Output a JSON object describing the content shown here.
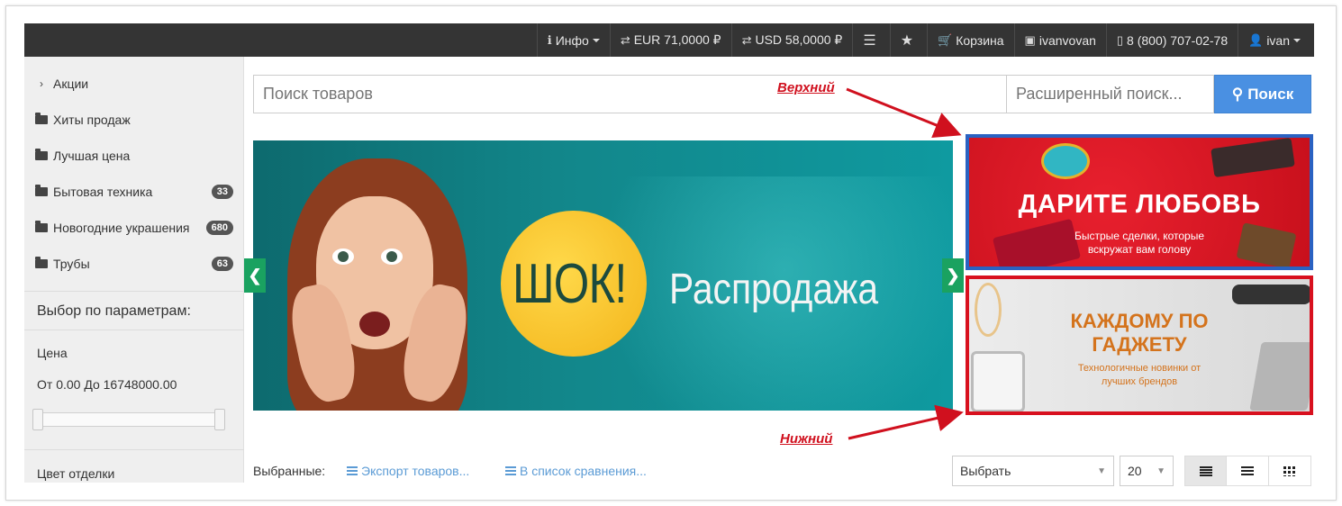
{
  "topbar": {
    "info": "Инфо",
    "eur": "EUR 71,0000 ₽",
    "usd": "USD 58,0000 ₽",
    "cart": "Корзина",
    "company": "ivanvovan",
    "phone": "8 (800) 707-02-78",
    "user": "ivan"
  },
  "sidebar": {
    "items": [
      {
        "label": "Акции",
        "icon": "chevron-right-icon"
      },
      {
        "label": "Хиты продаж",
        "icon": "folder-icon"
      },
      {
        "label": "Лучшая цена",
        "icon": "folder-icon"
      },
      {
        "label": "Бытовая техника",
        "icon": "folder-icon",
        "badge": "33"
      },
      {
        "label": "Новогодние украшения",
        "icon": "folder-icon",
        "badge": "680"
      },
      {
        "label": "Трубы",
        "icon": "folder-icon",
        "badge": "63"
      }
    ],
    "filter_title": "Выбор по параметрам:",
    "price_label": "Цена",
    "price_range": "От 0.00 До 16748000.00",
    "color_label": "Цвет отделки"
  },
  "search": {
    "placeholder": "Поиск товаров",
    "advanced_placeholder": "Расширенный поиск...",
    "button": "Поиск"
  },
  "hero": {
    "shock_text": "ШОК!",
    "sale_text": "Распродажа",
    "prev": "❮",
    "next": "❯"
  },
  "banners": {
    "top": {
      "headline": "ДАРИТЕ ЛЮБОВЬ",
      "sub": "Быстрые сделки, которые вскружат вам голову",
      "border_color": "#2a62c2"
    },
    "bottom": {
      "headline": "КАЖДОМУ ПО ГАДЖЕТУ",
      "sub": "Технологичные новинки от лучших брендов",
      "border_color": "#d8101e"
    }
  },
  "annotations": {
    "top": "Верхний",
    "bottom": "Нижний"
  },
  "toolbar": {
    "chosen": "Выбранные:",
    "export": "Экспорт товаров...",
    "compare": "В список сравнения...",
    "select": "Выбрать",
    "per_page": "20"
  },
  "colors": {
    "accent": "#4a90e2",
    "topbar": "#343434",
    "slider_arrow": "#1aa260",
    "annotation": "#d0101e"
  }
}
